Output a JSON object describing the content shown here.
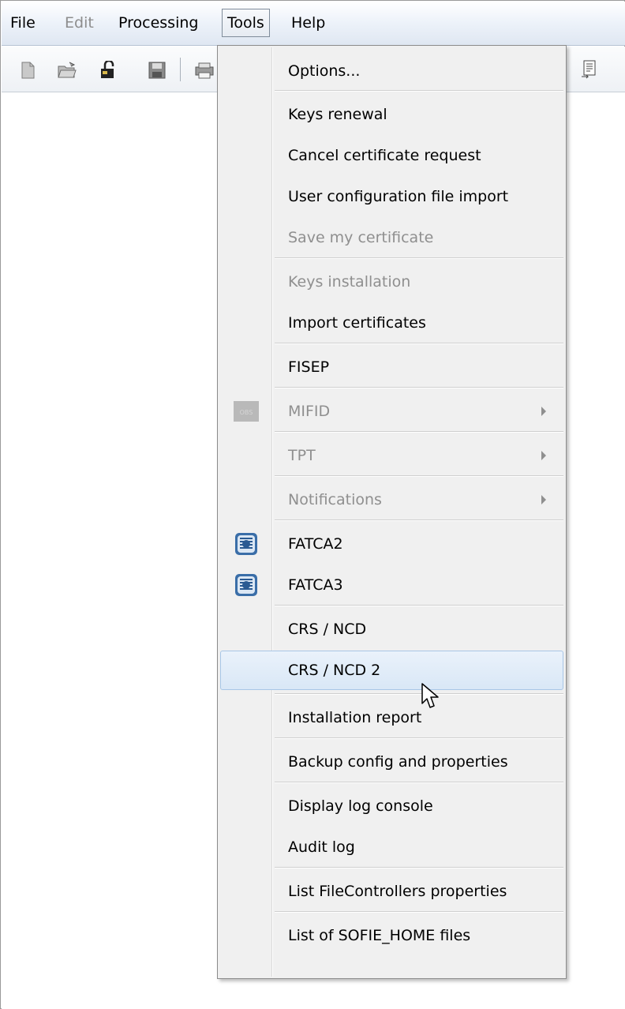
{
  "menubar": {
    "items": [
      {
        "label": "File",
        "enabled": true
      },
      {
        "label": "Edit",
        "enabled": false
      },
      {
        "label": "Processing",
        "enabled": true
      },
      {
        "label": "Tools",
        "enabled": true,
        "open": true
      },
      {
        "label": "Help",
        "enabled": true
      }
    ]
  },
  "toolbar": {
    "icons": [
      "new-file-icon",
      "open-folder-icon",
      "unlock-icon",
      "save-icon",
      "print-icon",
      "document-icon"
    ]
  },
  "tools_menu": {
    "items": [
      {
        "label": "Options...",
        "enabled": true
      },
      {
        "label": "Keys renewal",
        "enabled": true
      },
      {
        "label": "Cancel certificate request",
        "enabled": true
      },
      {
        "label": "User configuration file import",
        "enabled": true
      },
      {
        "label": "Save my certificate",
        "enabled": false
      },
      {
        "label": "Keys installation",
        "enabled": false
      },
      {
        "label": "Import certificates",
        "enabled": true
      },
      {
        "label": "FISEP",
        "enabled": true
      },
      {
        "label": "MIFID",
        "enabled": false,
        "submenu": true,
        "icon": "mifid-icon"
      },
      {
        "label": "TPT",
        "enabled": false,
        "submenu": true
      },
      {
        "label": "Notifications",
        "enabled": false,
        "submenu": true
      },
      {
        "label": "FATCA2",
        "enabled": true,
        "icon": "irs-seal-icon"
      },
      {
        "label": "FATCA3",
        "enabled": true,
        "icon": "irs-seal-icon"
      },
      {
        "label": "CRS / NCD",
        "enabled": true
      },
      {
        "label": "CRS / NCD 2",
        "enabled": true,
        "highlighted": true
      },
      {
        "label": "Installation report",
        "enabled": true
      },
      {
        "label": "Backup config and properties",
        "enabled": true
      },
      {
        "label": "Display log console",
        "enabled": true
      },
      {
        "label": "Audit log",
        "enabled": true
      },
      {
        "label": "List FileControllers properties",
        "enabled": true
      },
      {
        "label": "List of SOFIE_HOME files",
        "enabled": true
      }
    ]
  },
  "colors": {
    "menu_background": "#f0f0f0",
    "highlight": "#d9e7f6",
    "disabled_text": "#8f8f8f"
  }
}
